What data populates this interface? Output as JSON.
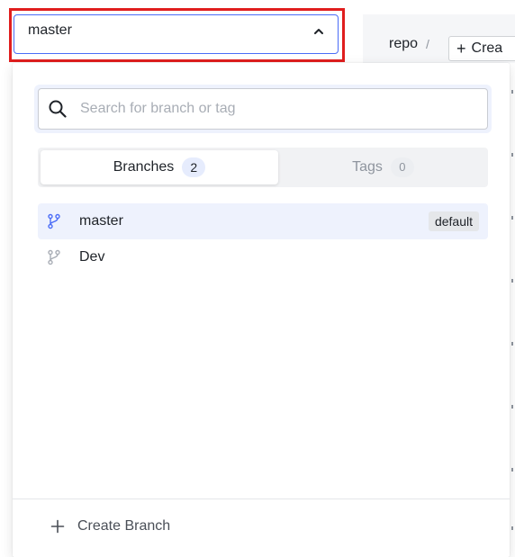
{
  "selector": {
    "value": "master"
  },
  "header": {
    "repo_name": "repo",
    "separator": "/",
    "create_label": "Crea"
  },
  "search": {
    "placeholder": "Search for branch or tag",
    "value": ""
  },
  "tabs": [
    {
      "label": "Branches",
      "count": "2",
      "active": true
    },
    {
      "label": "Tags",
      "count": "0",
      "active": false
    }
  ],
  "branches": [
    {
      "name": "master",
      "badge": "default",
      "selected": true
    },
    {
      "name": "Dev",
      "badge": "",
      "selected": false
    }
  ],
  "footer": {
    "create_branch_label": "Create Branch"
  },
  "colors": {
    "highlight_frame": "#e01e1e",
    "accent": "#4a6cf7",
    "selected_row_bg": "#eef2fd"
  },
  "icons": {
    "chevron": "chevron-up-icon",
    "search": "search-icon",
    "branch": "git-branch-icon",
    "add": "plus-icon"
  }
}
